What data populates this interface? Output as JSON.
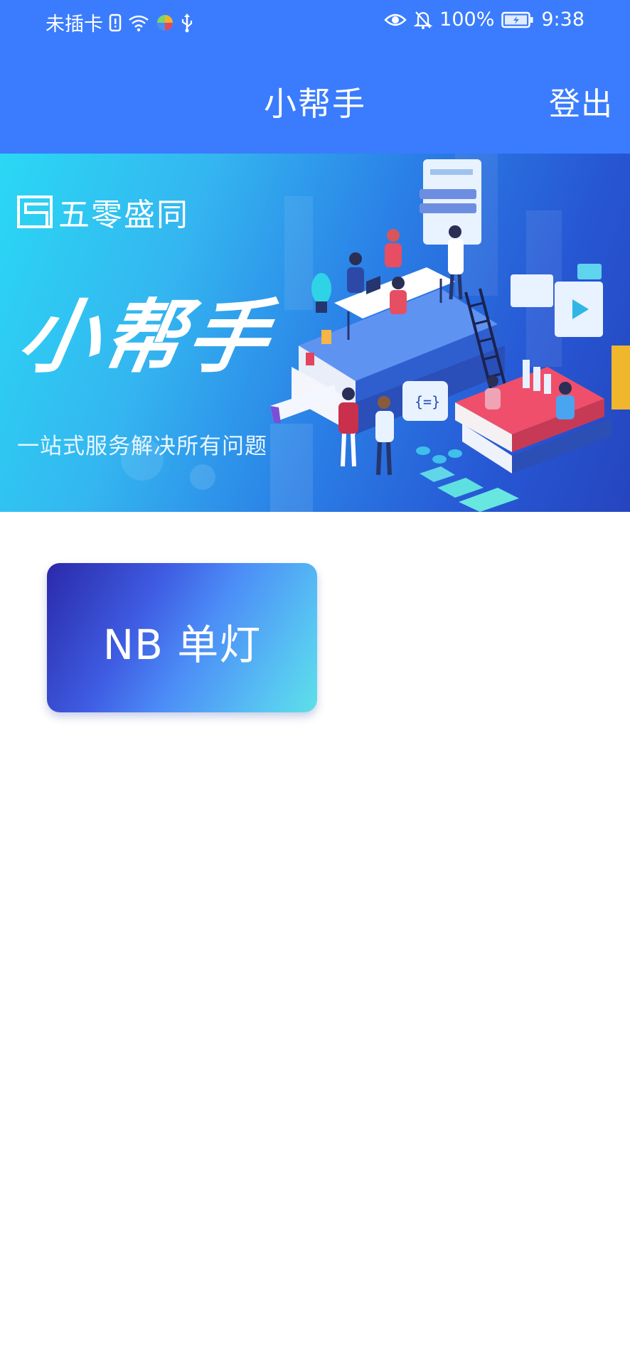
{
  "status_bar": {
    "carrier": "未插卡",
    "battery": "100%",
    "time": "9:38",
    "icons": [
      "sim-alert-icon",
      "wifi-icon",
      "app-icon",
      "usb-icon",
      "eye-icon",
      "bell-off-icon",
      "battery-icon"
    ]
  },
  "header": {
    "title": "小帮手",
    "logout_label": "登出",
    "background_color": "#3a7cfd"
  },
  "banner": {
    "brand": "五零盛同",
    "title": "小帮手",
    "slogan": "一站式服务解决所有问题"
  },
  "cards": [
    {
      "label": "NB 单灯"
    }
  ]
}
